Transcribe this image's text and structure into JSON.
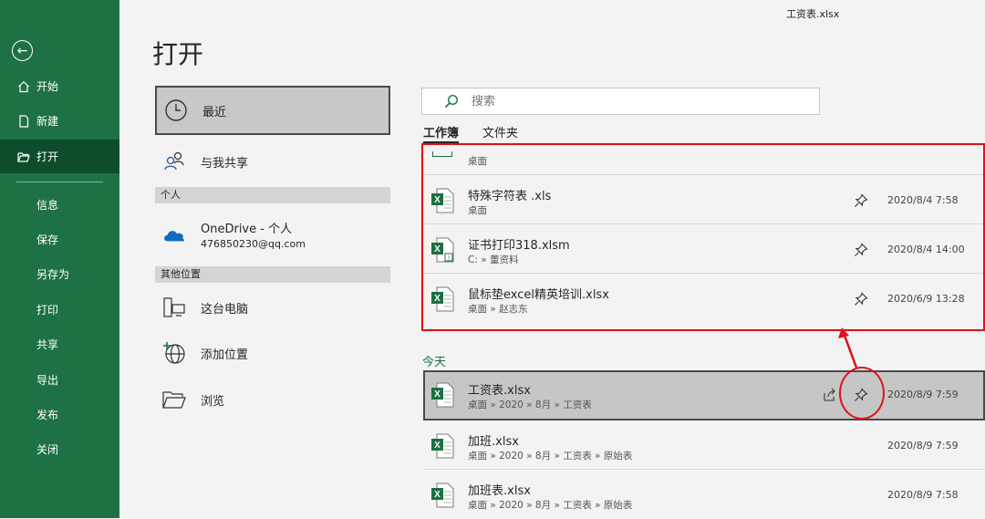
{
  "window": {
    "title": "工资表.xlsx"
  },
  "nav": {
    "back_label": "←",
    "items": [
      {
        "label": "开始",
        "icon": "home-icon"
      },
      {
        "label": "新建",
        "icon": "new-file-icon"
      },
      {
        "label": "打开",
        "icon": "open-folder-icon",
        "active": true
      },
      {
        "label": "信息"
      },
      {
        "label": "保存"
      },
      {
        "label": "另存为"
      },
      {
        "label": "打印"
      },
      {
        "label": "共享"
      },
      {
        "label": "导出"
      },
      {
        "label": "发布"
      },
      {
        "label": "关闭"
      }
    ]
  },
  "page": {
    "title": "打开"
  },
  "locations": {
    "recent": "最近",
    "shared": "与我共享",
    "personal_header": "个人",
    "onedrive_name": "OneDrive - 个人",
    "onedrive_email": "476850230@qq.com",
    "other_header": "其他位置",
    "this_pc": "这台电脑",
    "add_place": "添加位置",
    "browse": "浏览"
  },
  "search": {
    "placeholder": "搜索"
  },
  "tabs": {
    "workbooks": "工作簿",
    "folders": "文件夹"
  },
  "pinned_files": [
    {
      "name": "",
      "path": "桌面",
      "date": ""
    },
    {
      "name": "特殊字符表 .xls",
      "path": "桌面",
      "date": "2020/8/4 7:58"
    },
    {
      "name": "证书打印318.xlsm",
      "path": "C: » 董资料",
      "date": "2020/8/4 14:00"
    },
    {
      "name": "鼠标垫excel精英培训.xlsx",
      "path": "桌面 » 赵志东",
      "date": "2020/6/9 13:28"
    }
  ],
  "today_label": "今天",
  "today_files": [
    {
      "name": "工资表.xlsx",
      "path": "桌面 » 2020 » 8月 » 工资表",
      "date": "2020/8/9 7:59",
      "selected": true
    },
    {
      "name": "加班.xlsx",
      "path": "桌面 » 2020 » 8月 » 工资表 » 原始表",
      "date": "2020/8/9 7:59"
    },
    {
      "name": "加班表.xlsx",
      "path": "桌面 » 2020 » 8月 » 工资表 » 原始表",
      "date": "2020/8/9 7:58"
    }
  ],
  "colors": {
    "nav_bg": "#1e7145",
    "nav_active": "#0d4d2b",
    "excel_green": "#1d6f42",
    "highlight_red": "#e0101a"
  }
}
